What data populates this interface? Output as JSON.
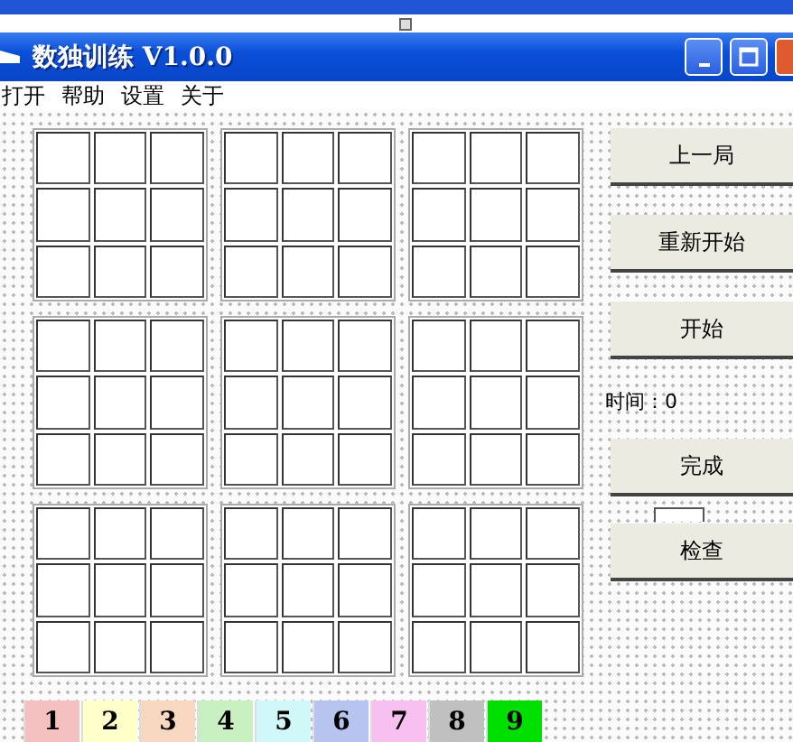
{
  "window": {
    "title": "数独训练 V1.0.0"
  },
  "menu": [
    "打开",
    "帮助",
    "设置",
    "关于"
  ],
  "buttons": [
    {
      "label": "上一局"
    },
    {
      "label": "重新开始"
    },
    {
      "label": "开始"
    }
  ],
  "timer": "时间：0",
  "buttons_lower": [
    {
      "label": "完成"
    },
    {
      "label": "检查"
    }
  ],
  "palette": [
    {
      "label": "1",
      "color": "#f4c0c0"
    },
    {
      "label": "2",
      "color": "#ffffc8"
    },
    {
      "label": "3",
      "color": "#f8d8c0"
    },
    {
      "label": "4",
      "color": "#c8f0c0"
    },
    {
      "label": "5",
      "color": "#d0f8f8"
    },
    {
      "label": "6",
      "color": "#b8c4f0"
    },
    {
      "label": "7",
      "color": "#f8c0f0"
    },
    {
      "label": "8",
      "color": "#c0c0c0"
    },
    {
      "label": "9",
      "color": "#00e000"
    }
  ]
}
